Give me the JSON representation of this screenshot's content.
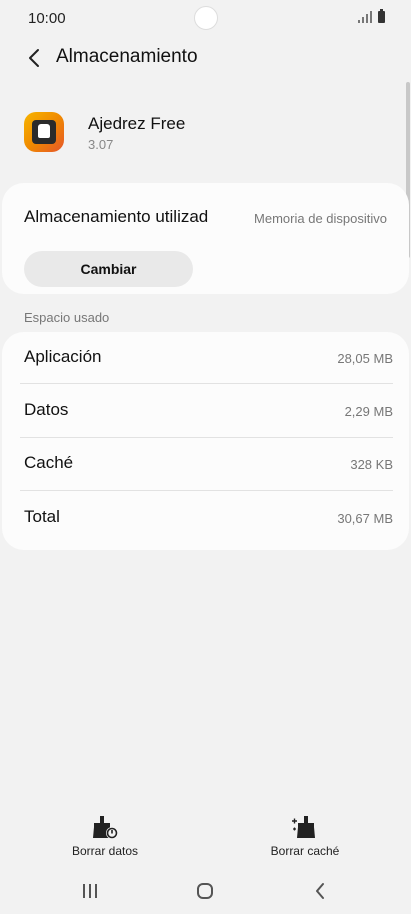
{
  "status_bar": {
    "time": "10:00"
  },
  "header": {
    "title": "Almacenamiento",
    "back_icon": "chevron-left-icon"
  },
  "app": {
    "name": "Ajedrez Free",
    "version": "3.07"
  },
  "storage": {
    "label": "Almacenamiento utilizad",
    "value": "Memoria de dispositivo",
    "change_button": "Cambiar"
  },
  "space_used": {
    "section_title": "Espacio usado",
    "rows": [
      {
        "label": "Aplicación",
        "value": "28,05 MB"
      },
      {
        "label": "Datos",
        "value": "2,29 MB"
      },
      {
        "label": "Caché",
        "value": "328 KB"
      },
      {
        "label": "Total",
        "value": "30,67 MB"
      }
    ]
  },
  "actions": {
    "clear_data": "Borrar datos",
    "clear_cache": "Borrar caché"
  }
}
